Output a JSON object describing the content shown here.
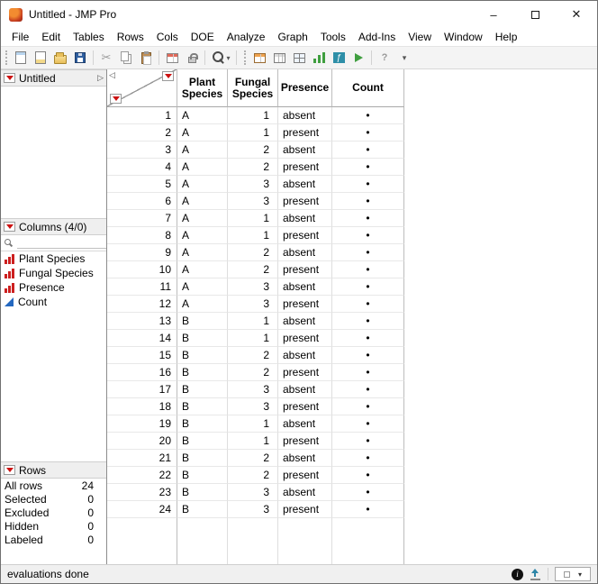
{
  "window": {
    "title": "Untitled - JMP Pro"
  },
  "icons": {
    "minimize": "–",
    "close": "✕",
    "collapse_left": "◁",
    "expander": "▷",
    "dropdown": "▾",
    "info": "i"
  },
  "menu": {
    "items": [
      "File",
      "Edit",
      "Tables",
      "Rows",
      "Cols",
      "DOE",
      "Analyze",
      "Graph",
      "Tools",
      "Add-Ins",
      "View",
      "Window",
      "Help"
    ]
  },
  "toolbar": {
    "groups": [
      [
        "new-data-table",
        "new-journal",
        "open-file",
        "save"
      ],
      [
        "cut",
        "copy",
        "paste"
      ],
      [
        "copy-table",
        "lock"
      ],
      [
        "zoom"
      ],
      [
        "new-table",
        "summary",
        "split-layout",
        "graph-builder",
        "formula-editor",
        "run-script"
      ],
      [
        "help",
        "overflow"
      ]
    ]
  },
  "sidebar": {
    "table_panel": {
      "title": "Untitled"
    },
    "columns_panel": {
      "title": "Columns (4/0)",
      "items": [
        {
          "label": "Plant Species",
          "type": "nominal"
        },
        {
          "label": "Fungal Species",
          "type": "nominal"
        },
        {
          "label": "Presence",
          "type": "nominal"
        },
        {
          "label": "Count",
          "type": "continuous"
        }
      ]
    },
    "rows_panel": {
      "title": "Rows",
      "stats": [
        {
          "label": "All rows",
          "value": "24"
        },
        {
          "label": "Selected",
          "value": "0"
        },
        {
          "label": "Excluded",
          "value": "0"
        },
        {
          "label": "Hidden",
          "value": "0"
        },
        {
          "label": "Labeled",
          "value": "0"
        }
      ]
    }
  },
  "table": {
    "columns": [
      "Plant Species",
      "Fungal Species",
      "Presence",
      "Count"
    ],
    "rows": [
      {
        "n": "1",
        "plant": "A",
        "fungal": "1",
        "presence": "absent",
        "count": "•"
      },
      {
        "n": "2",
        "plant": "A",
        "fungal": "1",
        "presence": "present",
        "count": "•"
      },
      {
        "n": "3",
        "plant": "A",
        "fungal": "2",
        "presence": "absent",
        "count": "•"
      },
      {
        "n": "4",
        "plant": "A",
        "fungal": "2",
        "presence": "present",
        "count": "•"
      },
      {
        "n": "5",
        "plant": "A",
        "fungal": "3",
        "presence": "absent",
        "count": "•"
      },
      {
        "n": "6",
        "plant": "A",
        "fungal": "3",
        "presence": "present",
        "count": "•"
      },
      {
        "n": "7",
        "plant": "A",
        "fungal": "1",
        "presence": "absent",
        "count": "•"
      },
      {
        "n": "8",
        "plant": "A",
        "fungal": "1",
        "presence": "present",
        "count": "•"
      },
      {
        "n": "9",
        "plant": "A",
        "fungal": "2",
        "presence": "absent",
        "count": "•"
      },
      {
        "n": "10",
        "plant": "A",
        "fungal": "2",
        "presence": "present",
        "count": "•"
      },
      {
        "n": "11",
        "plant": "A",
        "fungal": "3",
        "presence": "absent",
        "count": "•"
      },
      {
        "n": "12",
        "plant": "A",
        "fungal": "3",
        "presence": "present",
        "count": "•"
      },
      {
        "n": "13",
        "plant": "B",
        "fungal": "1",
        "presence": "absent",
        "count": "•"
      },
      {
        "n": "14",
        "plant": "B",
        "fungal": "1",
        "presence": "present",
        "count": "•"
      },
      {
        "n": "15",
        "plant": "B",
        "fungal": "2",
        "presence": "absent",
        "count": "•"
      },
      {
        "n": "16",
        "plant": "B",
        "fungal": "2",
        "presence": "present",
        "count": "•"
      },
      {
        "n": "17",
        "plant": "B",
        "fungal": "3",
        "presence": "absent",
        "count": "•"
      },
      {
        "n": "18",
        "plant": "B",
        "fungal": "3",
        "presence": "present",
        "count": "•"
      },
      {
        "n": "19",
        "plant": "B",
        "fungal": "1",
        "presence": "absent",
        "count": "•"
      },
      {
        "n": "20",
        "plant": "B",
        "fungal": "1",
        "presence": "present",
        "count": "•"
      },
      {
        "n": "21",
        "plant": "B",
        "fungal": "2",
        "presence": "absent",
        "count": "•"
      },
      {
        "n": "22",
        "plant": "B",
        "fungal": "2",
        "presence": "present",
        "count": "•"
      },
      {
        "n": "23",
        "plant": "B",
        "fungal": "3",
        "presence": "absent",
        "count": "•"
      },
      {
        "n": "24",
        "plant": "B",
        "fungal": "3",
        "presence": "present",
        "count": "•"
      }
    ]
  },
  "status": {
    "text": "evaluations done"
  }
}
